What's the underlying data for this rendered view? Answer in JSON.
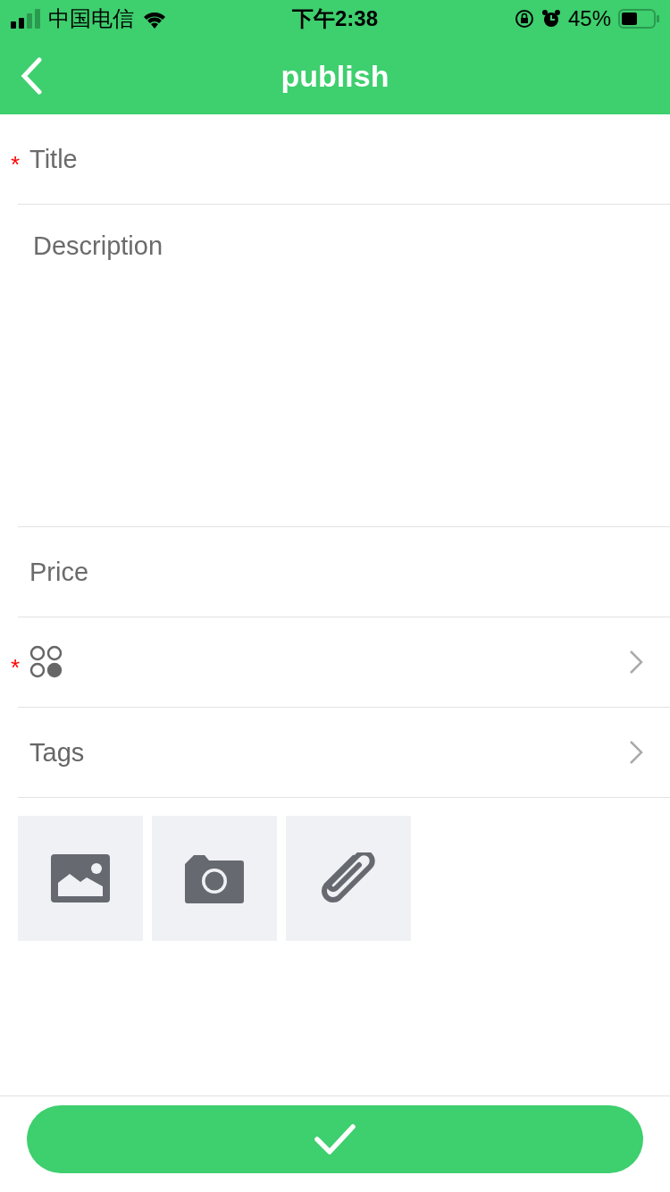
{
  "status_bar": {
    "carrier": "中国电信",
    "time": "下午2:38",
    "battery": "45%"
  },
  "nav_bar": {
    "title": "publish"
  },
  "form": [
    {
      "kind": "input",
      "placeholder": "Title",
      "required_mark": "*"
    },
    {
      "kind": "textarea",
      "placeholder": "Description"
    },
    {
      "kind": "input",
      "placeholder": "Price"
    },
    {
      "kind": "category",
      "required_mark": "*"
    },
    {
      "kind": "picker",
      "label": "Tags"
    }
  ],
  "attachments": [
    {
      "kind": "image"
    },
    {
      "kind": "camera"
    },
    {
      "kind": "file"
    }
  ],
  "submit": {
    "kind": "check"
  }
}
